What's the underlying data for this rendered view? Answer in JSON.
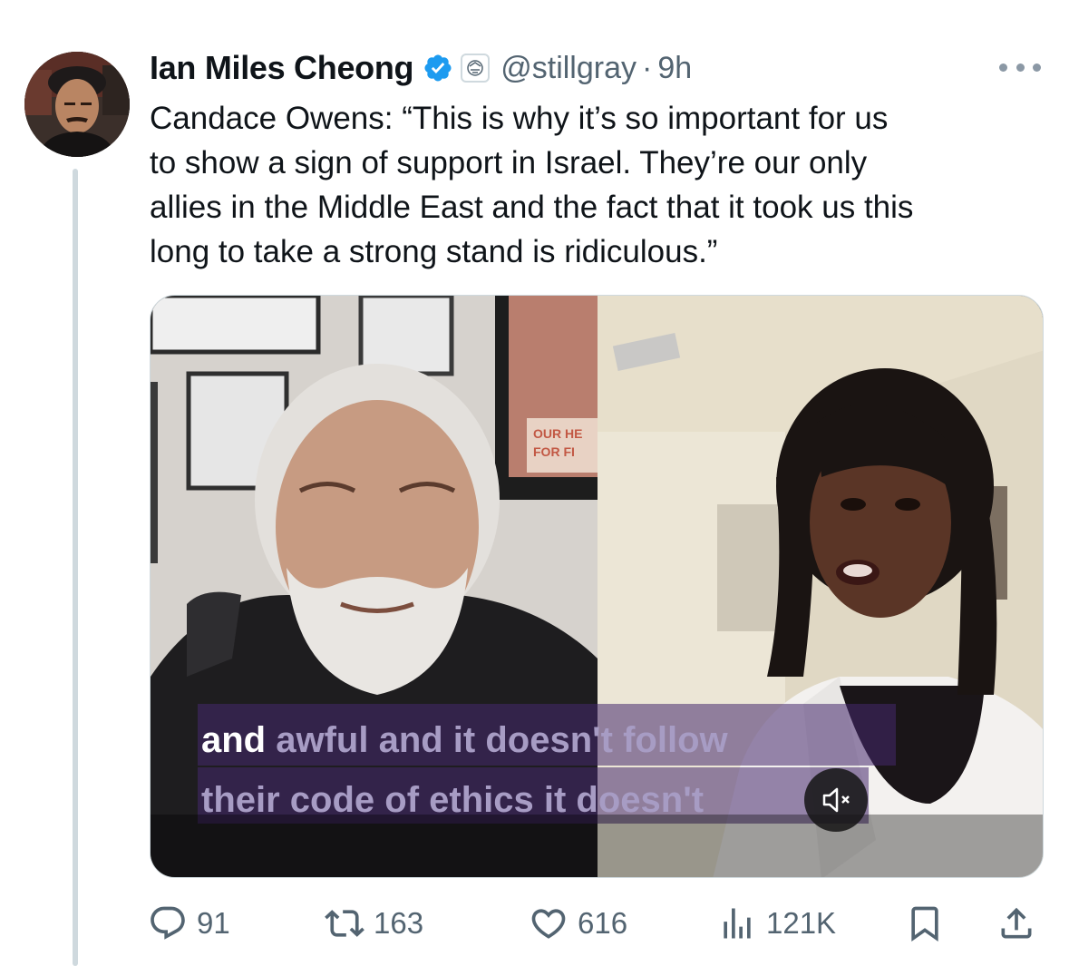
{
  "author": {
    "name": "Ian Miles Cheong",
    "handle": "@stillgray",
    "separator": "·",
    "time": "9h"
  },
  "tweet": {
    "text": "Candace Owens: “This is why it’s so important for us\nto show a sign of support in Israel. They’re our only\nallies in the Middle East and the fact that it took us this\nlong to take a strong stand is ridiculous.”"
  },
  "media": {
    "caption_first": "and",
    "caption_rest": " awful and it doesn't follow\ntheir code of ethics it doesn't",
    "poster_text_line1": "OUR HE",
    "poster_text_line2": "FOR FI",
    "mute_icon": "volume-muted-icon"
  },
  "actions": {
    "replies": "91",
    "reposts": "163",
    "likes": "616",
    "views": "121K"
  },
  "icons": {
    "verified": "verified-badge-icon",
    "affiliation": "affiliate-badge-icon",
    "more": "more-horizontal-icon",
    "reply": "reply-icon",
    "repost": "repost-icon",
    "like": "like-icon",
    "views": "views-icon",
    "bookmark": "bookmark-icon",
    "share": "share-icon"
  },
  "colors": {
    "accent": "#1d9bf0",
    "secondary_text": "#536471",
    "caption_purple": "#a79cc4"
  }
}
